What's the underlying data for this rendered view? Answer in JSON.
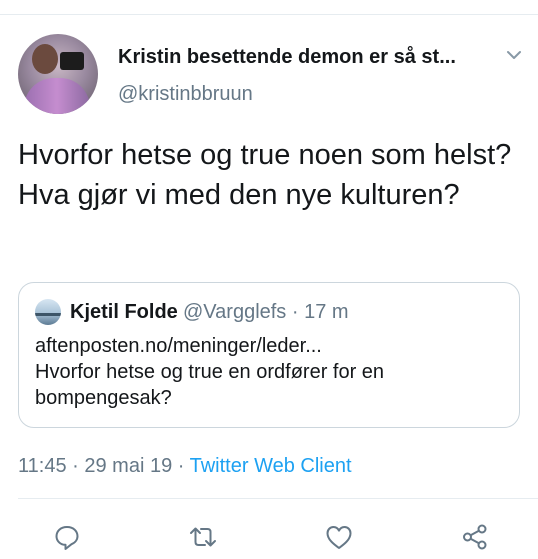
{
  "tweet": {
    "display_name": "Kristin besettende demon er så st...",
    "handle": "@kristinbbruun",
    "text": "Hvorfor hetse og true noen som helst? Hva gjør vi med den nye kulturen?"
  },
  "quoted_tweet": {
    "name": "Kjetil Folde",
    "handle_time": "@Vargglefs · 17 m",
    "link": "aftenposten.no/meninger/leder...",
    "text": "Hvorfor hetse og true en ordfører for en bompengesak?"
  },
  "meta": {
    "time": "11:45",
    "sep1": " · ",
    "date": "29 mai 19",
    "sep2": " · ",
    "source": "Twitter Web Client"
  },
  "actions": {
    "reply_icon": "reply-icon",
    "retweet_icon": "retweet-icon",
    "like_icon": "heart-icon",
    "share_icon": "share-icon"
  },
  "colors": {
    "text": "#14171a",
    "secondary": "#657786",
    "link": "#1da1f2",
    "border": "#ccd6dd"
  }
}
